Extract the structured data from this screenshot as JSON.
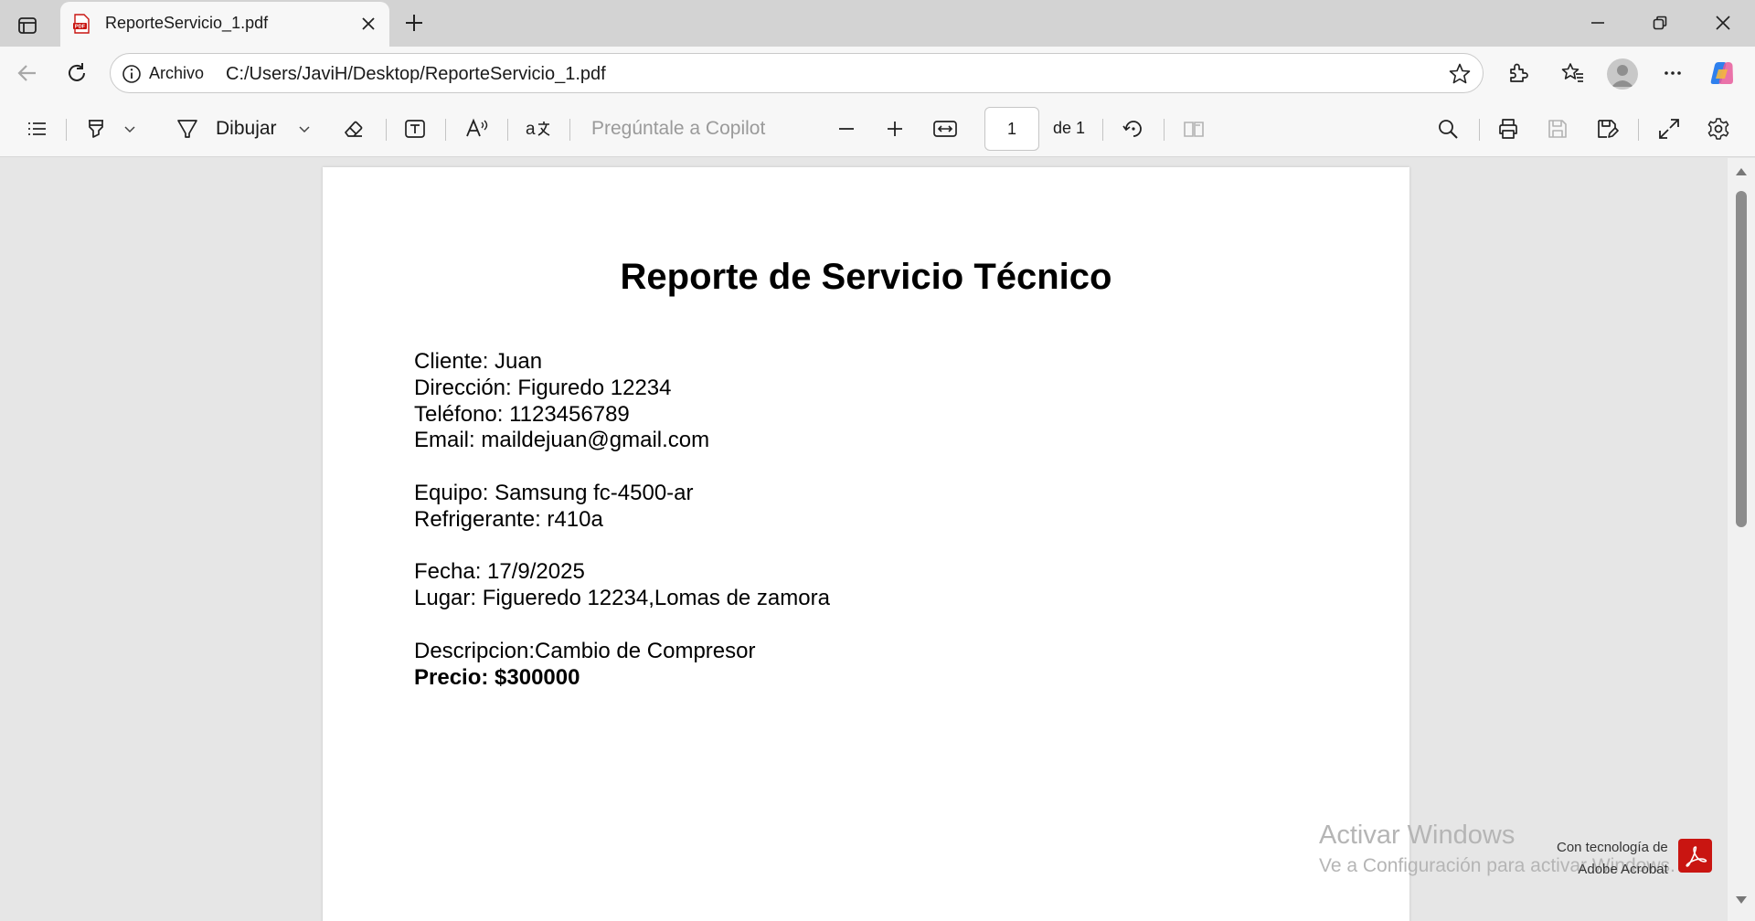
{
  "browser": {
    "tab_title": "ReportePdfTab",
    "tab_label": "ReporteServicio_1.pdf",
    "address_prefix": "Archivo",
    "url": "C:/Users/JaviH/Desktop/ReporteServicio_1.pdf"
  },
  "toolbar": {
    "draw_label": "Dibujar",
    "copilot_placeholder": "Pregúntale a Copilot",
    "page_current": "1",
    "page_total": "de 1"
  },
  "document": {
    "title": "Reporte de Servicio Técnico",
    "lines": {
      "cliente": "Cliente: Juan",
      "direccion": "Dirección: Figuredo 12234",
      "telefono": "Teléfono: 1123456789",
      "email": "Email: maildejuan@gmail.com",
      "equipo": "Equipo: Samsung fc-4500-ar",
      "refrigerante": "Refrigerante: r410a",
      "fecha": "Fecha: 17/9/2025",
      "lugar": "Lugar: Figueredo 12234,Lomas de zamora",
      "descripcion": "Descripcion:Cambio de Compresor",
      "precio": "Precio: $300000"
    }
  },
  "watermark": {
    "title": "Activar Windows",
    "subtitle": "Ve a Configuración para activar Windows.",
    "powered_by_line1": "Con tecnología de",
    "powered_by_line2": "Adobe Acrobat"
  },
  "icons": {
    "favicon": "pdf-file-icon",
    "accent": "#c91511"
  }
}
